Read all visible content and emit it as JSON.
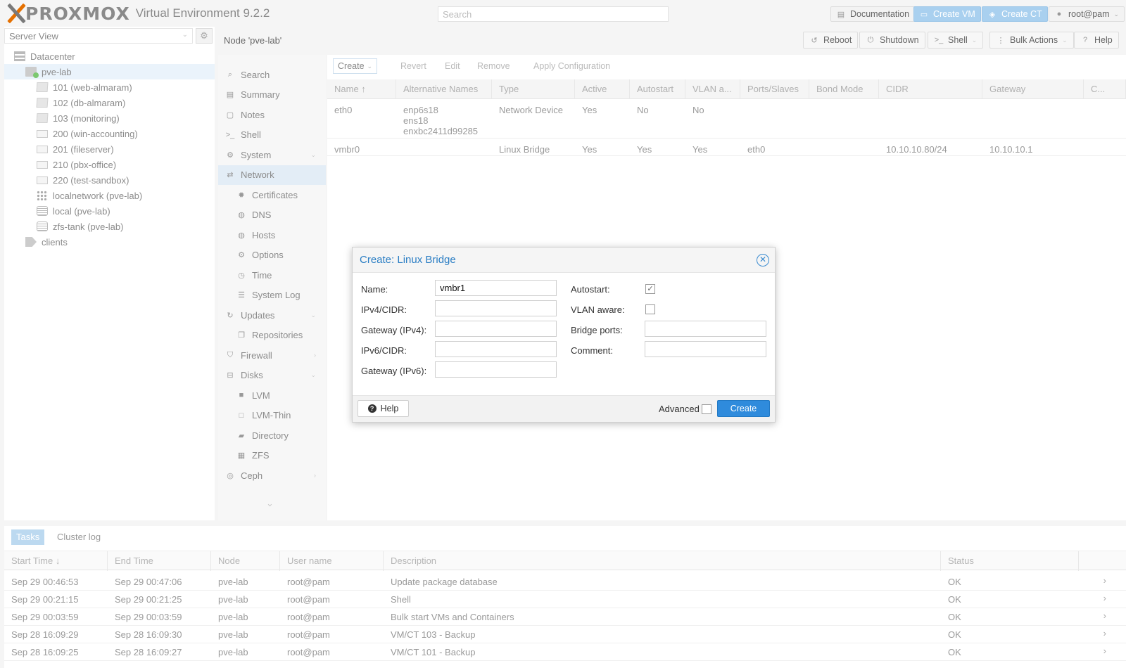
{
  "header": {
    "logo_text": "PROXMOX",
    "product": "Virtual Environment 9.2.2",
    "search_placeholder": "Search",
    "buttons": {
      "documentation": "Documentation",
      "create_vm": "Create VM",
      "create_ct": "Create CT",
      "user": "root@pam"
    }
  },
  "sidebar": {
    "view": "Server View",
    "tree": [
      {
        "label": "Datacenter",
        "icon": "datacenter-icon"
      },
      {
        "label": "pve-lab",
        "icon": "node-online-icon"
      },
      {
        "label": "101 (web-almaram)",
        "icon": "container-icon"
      },
      {
        "label": "102 (db-almaram)",
        "icon": "container-icon"
      },
      {
        "label": "103 (monitoring)",
        "icon": "container-icon"
      },
      {
        "label": "200 (win-accounting)",
        "icon": "vm-icon"
      },
      {
        "label": "201 (fileserver)",
        "icon": "vm-icon"
      },
      {
        "label": "210 (pbx-office)",
        "icon": "vm-icon"
      },
      {
        "label": "220 (test-sandbox)",
        "icon": "vm-icon"
      },
      {
        "label": "localnetwork (pve-lab)",
        "icon": "sdn-icon"
      },
      {
        "label": "local (pve-lab)",
        "icon": "storage-icon"
      },
      {
        "label": "zfs-tank (pve-lab)",
        "icon": "storage-icon"
      },
      {
        "label": "clients",
        "icon": "tag-icon"
      }
    ]
  },
  "node": {
    "title": "Node 'pve-lab'",
    "actions": {
      "reboot": "Reboot",
      "shutdown": "Shutdown",
      "shell": "Shell",
      "bulk": "Bulk Actions",
      "help": "Help"
    }
  },
  "menu": [
    {
      "label": "Search",
      "icon": "search-icon"
    },
    {
      "label": "Summary",
      "icon": "book-icon"
    },
    {
      "label": "Notes",
      "icon": "notes-icon"
    },
    {
      "label": "Shell",
      "icon": "terminal-icon"
    },
    {
      "label": "System",
      "icon": "cogs-icon"
    },
    {
      "label": "Network",
      "icon": "exchange-icon"
    },
    {
      "label": "Certificates",
      "icon": "certificate-icon"
    },
    {
      "label": "DNS",
      "icon": "globe-icon"
    },
    {
      "label": "Hosts",
      "icon": "globe-icon"
    },
    {
      "label": "Options",
      "icon": "gear-icon"
    },
    {
      "label": "Time",
      "icon": "clock-icon"
    },
    {
      "label": "System Log",
      "icon": "list-icon"
    },
    {
      "label": "Updates",
      "icon": "refresh-icon"
    },
    {
      "label": "Repositories",
      "icon": "files-icon"
    },
    {
      "label": "Firewall",
      "icon": "shield-icon"
    },
    {
      "label": "Disks",
      "icon": "hdd-icon"
    },
    {
      "label": "LVM",
      "icon": "square-icon"
    },
    {
      "label": "LVM-Thin",
      "icon": "square-outline-icon"
    },
    {
      "label": "Directory",
      "icon": "folder-icon"
    },
    {
      "label": "ZFS",
      "icon": "th-large-icon"
    },
    {
      "label": "Ceph",
      "icon": "ceph-icon"
    }
  ],
  "network": {
    "toolbar": {
      "create": "Create",
      "revert": "Revert",
      "edit": "Edit",
      "remove": "Remove",
      "apply": "Apply Configuration"
    },
    "columns": [
      "Name ↑",
      "Alternative Names",
      "Type",
      "Active",
      "Autostart",
      "VLAN a...",
      "Ports/Slaves",
      "Bond Mode",
      "CIDR",
      "Gateway",
      "C..."
    ],
    "rows": [
      {
        "name": "eth0",
        "alt1": "enp6s18",
        "alt2": "ens18",
        "alt3": "enxbc2411d99285",
        "type": "Network Device",
        "active": "Yes",
        "autostart": "No",
        "vlan": "No",
        "ports": "",
        "bond": "",
        "cidr": "",
        "gateway": ""
      },
      {
        "name": "vmbr0",
        "alt1": "",
        "alt2": "",
        "alt3": "",
        "type": "Linux Bridge",
        "active": "Yes",
        "autostart": "Yes",
        "vlan": "Yes",
        "ports": "eth0",
        "bond": "",
        "cidr": "10.10.10.80/24",
        "gateway": "10.10.10.1"
      }
    ]
  },
  "dialog": {
    "title": "Create: Linux Bridge",
    "labels": {
      "name": "Name:",
      "ipv4": "IPv4/CIDR:",
      "gw4": "Gateway (IPv4):",
      "ipv6": "IPv6/CIDR:",
      "gw6": "Gateway (IPv6):",
      "autostart": "Autostart:",
      "vlan": "VLAN aware:",
      "ports": "Bridge ports:",
      "comment": "Comment:"
    },
    "values": {
      "name": "vmbr1",
      "ipv4": "",
      "gw4": "",
      "ipv6": "",
      "gw6": "",
      "ports": "",
      "comment": ""
    },
    "autostart_checked": true,
    "vlan_checked": false,
    "advanced_checked": false,
    "help": "Help",
    "advanced": "Advanced",
    "create": "Create"
  },
  "tasks": {
    "tabs": [
      "Tasks",
      "Cluster log"
    ],
    "columns": [
      "Start Time ↓",
      "End Time",
      "Node",
      "User name",
      "Description",
      "Status"
    ],
    "rows": [
      {
        "start": "Sep 29 00:46:53",
        "end": "Sep 29 00:47:06",
        "node": "pve-lab",
        "user": "root@pam",
        "desc": "Update package database",
        "status": "OK"
      },
      {
        "start": "Sep 29 00:21:15",
        "end": "Sep 29 00:21:25",
        "node": "pve-lab",
        "user": "root@pam",
        "desc": "Shell",
        "status": "OK"
      },
      {
        "start": "Sep 29 00:03:59",
        "end": "Sep 29 00:03:59",
        "node": "pve-lab",
        "user": "root@pam",
        "desc": "Bulk start VMs and Containers",
        "status": "OK"
      },
      {
        "start": "Sep 28 16:09:29",
        "end": "Sep 28 16:09:30",
        "node": "pve-lab",
        "user": "root@pam",
        "desc": "VM/CT 103 - Backup",
        "status": "OK"
      },
      {
        "start": "Sep 28 16:09:25",
        "end": "Sep 28 16:09:27",
        "node": "pve-lab",
        "user": "root@pam",
        "desc": "VM/CT 101 - Backup",
        "status": "OK"
      }
    ]
  }
}
